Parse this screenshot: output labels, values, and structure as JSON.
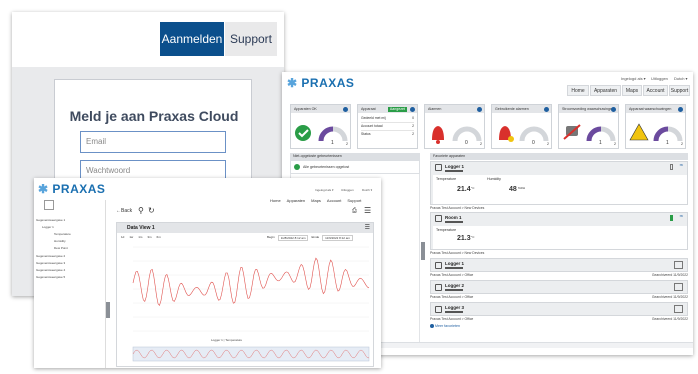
{
  "login": {
    "nav_login": "Aanmelden",
    "nav_support": "Support",
    "title": "Meld je aan Praxas Cloud",
    "email_placeholder": "Email",
    "password_placeholder": "Wachtwoord"
  },
  "dashboard": {
    "logo": "PRAXAS",
    "user_links": [
      "Ingelogd als ▾",
      "Uitloggen",
      "Dutch ▾"
    ],
    "nav": [
      "Home",
      "Apparaten",
      "Maps",
      "Account",
      "Support"
    ],
    "tiles": [
      {
        "title": "Apparaten OK",
        "value": "1",
        "max": "2",
        "icon": "check-circle-icon"
      },
      {
        "title": "Apparaat",
        "badge": "Aangezet",
        "rows": [
          [
            "Gedeeld met mij",
            "0"
          ],
          [
            "Account totaal",
            "2"
          ],
          [
            "Status",
            "2"
          ]
        ]
      },
      {
        "title": "Alarmen",
        "value": "0",
        "max": "2",
        "icon": "bell-icon"
      },
      {
        "title": "Gebruikerde alarmen",
        "value": "0",
        "max": "2",
        "icon": "bell-alert-icon"
      },
      {
        "title": "Stroomvoeding waarschuwingen",
        "value": "1",
        "max": "2",
        "icon": "plug-icon"
      },
      {
        "title": "Apparaat waarschuwingen",
        "value": "1",
        "max": "2",
        "icon": "warning-icon"
      }
    ],
    "unack_title": "Niet-opgeloste gebeurtenissen",
    "unack_text": "Alle gebeurtenissen opgelost",
    "favorites_title": "Favoriete apparaten",
    "devices": [
      {
        "name": "Logger 1",
        "readings": [
          [
            "Temperature",
            "21.4",
            "°C"
          ],
          [
            "Humidity",
            "48",
            "%RH"
          ]
        ],
        "footer": "Praxas Test Account > New Devices",
        "status": ""
      },
      {
        "name": "Room 1",
        "readings": [
          [
            "Temperature",
            "21.3",
            "°C"
          ]
        ],
        "footer": "Praxas Test Account > New Devices",
        "status": ""
      },
      {
        "name": "Logger 1",
        "readings": [],
        "footer": "Praxas Test Account > Office",
        "status": "Gearchiveerd 11/9/2022"
      },
      {
        "name": "Logger 2",
        "readings": [],
        "footer": "Praxas Test Account > Office",
        "status": "Gearchiveerd 11/9/2022"
      },
      {
        "name": "Logger 3",
        "readings": [],
        "footer": "Praxas Test Account > Office",
        "status": "Gearchiveerd 11/9/2022"
      }
    ],
    "more_favorites": "Meer favorieten"
  },
  "dataview": {
    "logo": "PRAXAS",
    "user_links": [
      "Ingelogd als ▾",
      "Uitloggen",
      "Dutch ▾"
    ],
    "nav": [
      "Home",
      "Apparaten",
      "Maps",
      "Account",
      "Support"
    ],
    "back_label": "Back",
    "chart_title": "Data View 1",
    "range_buttons": [
      "1d",
      "1w",
      "1m",
      "3m",
      "6m"
    ],
    "begin_label": "Begin",
    "begin_value": "11/8/2022 8:12 am",
    "end_label": "Einde",
    "end_value": "11/9/2022 8:12 am",
    "tree": [
      "Gegevensweergave 1",
      "Logger 1",
      "Temperature",
      "Humidity",
      "Dew Point",
      "Gegevensweergave 2",
      "Gegevensweergave 3",
      "Gegevensweergave 4",
      "Gegevensweergave 5"
    ],
    "legend": "Logger 1 | Temperature",
    "colors": {
      "series": "#e0524e"
    }
  }
}
